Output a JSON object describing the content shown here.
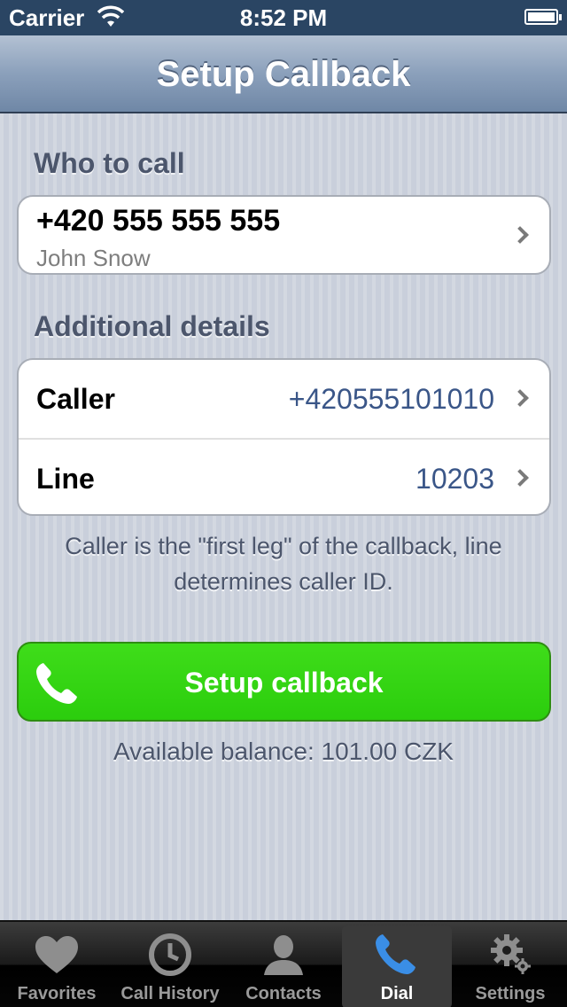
{
  "status_bar": {
    "carrier": "Carrier",
    "time": "8:52 PM"
  },
  "nav": {
    "title": "Setup Callback"
  },
  "who_to_call": {
    "header": "Who to call",
    "number": "+420 555 555 555",
    "name": "John Snow"
  },
  "additional_details": {
    "header": "Additional details",
    "rows": [
      {
        "label": "Caller",
        "value": "+420555101010"
      },
      {
        "label": "Line",
        "value": "10203"
      }
    ],
    "footnote": "Caller is the \"first leg\" of the callback, line determines caller ID."
  },
  "callback_button": {
    "label": "Setup callback",
    "icon": "phone-icon",
    "color": "#33d412"
  },
  "balance": "Available balance: 101.00 CZK",
  "tabs": [
    {
      "label": "Favorites",
      "icon": "heart-icon",
      "active": false
    },
    {
      "label": "Call History",
      "icon": "clock-icon",
      "active": false
    },
    {
      "label": "Contacts",
      "icon": "person-icon",
      "active": false
    },
    {
      "label": "Dial",
      "icon": "phone-icon",
      "active": true
    },
    {
      "label": "Settings",
      "icon": "gear-icon",
      "active": false
    }
  ],
  "colors": {
    "nav_bar": "#8ba0bb",
    "value_text": "#3a5688",
    "active_tab_icon": "#3a8ee6"
  }
}
